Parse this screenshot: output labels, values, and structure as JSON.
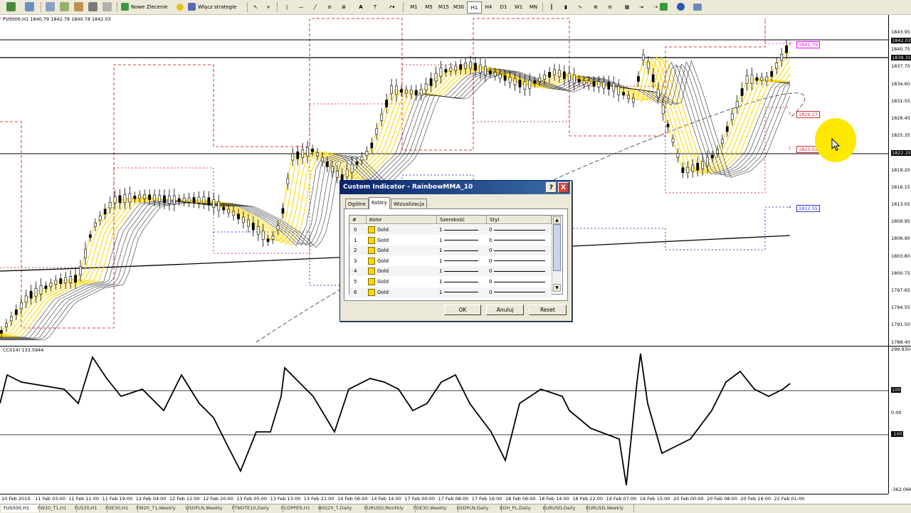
{
  "toolbar": {
    "new_order_label": "Nowe Zlecenie",
    "strategies_label": "Włącz strategie",
    "timeframes": [
      "M1",
      "M5",
      "M15",
      "M30",
      "H1",
      "H4",
      "D1",
      "W1",
      "MN"
    ],
    "active_timeframe": "H1"
  },
  "chart": {
    "header": "FUS500,H1  1840.79 1842.78 1840.78 1842.03",
    "price_labels": [
      "1843.95",
      "1840.75",
      "1837.70",
      "1834.60",
      "1831.55",
      "1828.45",
      "1825.35",
      "1822.25",
      "1819.20",
      "1816.15",
      "1813.05",
      "1809.95",
      "1806.90",
      "1803.80",
      "1800.75",
      "1797.65",
      "1794.55",
      "1791.50",
      "1788.40"
    ],
    "current_price_tag": "1842.03",
    "hline_tags": [
      "1839.32",
      "1822.25"
    ],
    "level_labels": [
      {
        "text": "1841.79",
        "color": "#ff00ff"
      },
      {
        "text": "1829.27",
        "color": "#cc3333"
      },
      {
        "text": "1823.02",
        "color": "#cc3333"
      },
      {
        "text": "1812.55",
        "color": "#3333cc"
      }
    ],
    "level_numbers": [
      "3",
      "2",
      "1",
      "4"
    ],
    "colors": {
      "ribbon": "#ffd700",
      "ribbon_dark": "#000000",
      "channel_red": "#cc0000",
      "channel_magenta": "#ff00ff",
      "channel_blue": "#0000cc",
      "highlight": "#ffe800"
    }
  },
  "cci": {
    "header": "CCI(14) 133.5944",
    "axis_labels": [
      "299.9304",
      "100",
      "0.00",
      "-100",
      "-362.0666"
    ]
  },
  "time_axis": [
    "10 Feb 2014",
    "11 Feb 03:00",
    "11 Feb 11:00",
    "11 Feb 19:00",
    "12 Feb 04:00",
    "12 Feb 12:00",
    "12 Feb 20:00",
    "13 Feb 05:00",
    "13 Feb 13:00",
    "13 Feb 21:00",
    "14 Feb 06:00",
    "14 Feb 14:00",
    "17 Feb 00:00",
    "17 Feb 08:00",
    "17 Feb 16:00",
    "18 Feb 06:00",
    "18 Feb 14:00",
    "18 Feb 22:00",
    "19 Feb 07:00",
    "19 Feb 15:00",
    "20 Feb 00:00",
    "20 Feb 08:00",
    "20 Feb 16:00",
    "21 Feb 01:00"
  ],
  "tabs": [
    "FUS500,H1",
    "FW20_T1,H1",
    "FUS30,H1",
    "FDE30,H1",
    "FW20_T1,Weekly",
    "USDPLN,Weekly",
    "FTNOTE10,Daily",
    "FCOPPER,H1",
    "WIG20_T,Daily",
    "EURUSD,Monthly",
    "FDE30,Weekly",
    "USDPLN,Daily",
    "KGH_PL,Daily",
    "EURUSD,Daily",
    "EURUSD,Weekly"
  ],
  "active_tab": "FUS500,H1",
  "dialog": {
    "title": "Custom Indicator - RainbowMMA_10",
    "tabs": [
      "Ogólne",
      "Kolory",
      "Wizualizacja"
    ],
    "selected_tab": "Kolory",
    "columns": [
      "#",
      "Kolor",
      "Szerokość",
      "Styl"
    ],
    "rows": [
      {
        "idx": "0",
        "color": "Gold",
        "width": "1",
        "style": "0"
      },
      {
        "idx": "1",
        "color": "Gold",
        "width": "1",
        "style": "0"
      },
      {
        "idx": "2",
        "color": "Gold",
        "width": "1",
        "style": "0"
      },
      {
        "idx": "3",
        "color": "Gold",
        "width": "1",
        "style": "0"
      },
      {
        "idx": "4",
        "color": "Gold",
        "width": "1",
        "style": "0"
      },
      {
        "idx": "5",
        "color": "Gold",
        "width": "1",
        "style": "0"
      },
      {
        "idx": "6",
        "color": "Gold",
        "width": "1",
        "style": "0"
      }
    ],
    "ok_label": "OK",
    "cancel_label": "Anuluj",
    "reset_label": "Reset",
    "help_label": "?",
    "close_label": "X"
  }
}
